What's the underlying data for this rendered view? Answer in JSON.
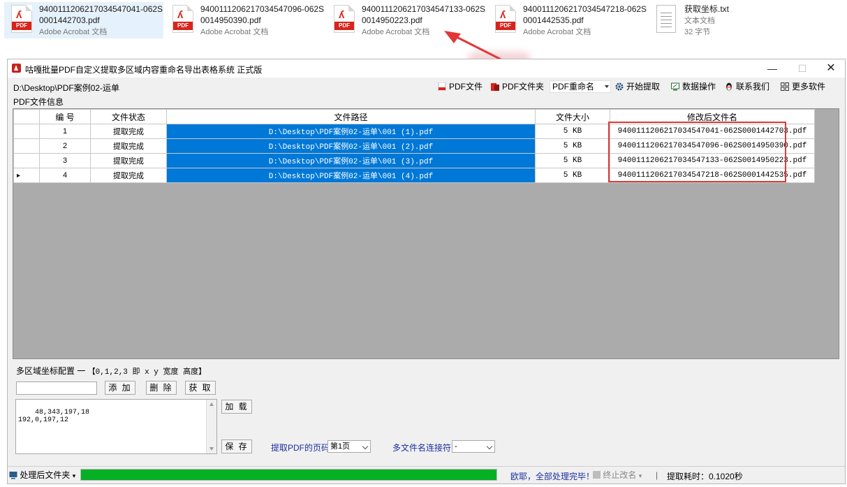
{
  "explorer": {
    "files": [
      {
        "name": "9400111206217034547041-062S0001442703.pdf",
        "type": "Adobe Acrobat 文档",
        "icon": "pdf-file-icon",
        "selected": true
      },
      {
        "name": "9400111206217034547096-062S0014950390.pdf",
        "type": "Adobe Acrobat 文档",
        "icon": "pdf-file-icon"
      },
      {
        "name": "9400111206217034547133-062S0014950223.pdf",
        "type": "Adobe Acrobat 文档",
        "icon": "pdf-file-icon"
      },
      {
        "name": "9400111206217034547218-062S0001442535.pdf",
        "type": "Adobe Acrobat 文档",
        "icon": "pdf-file-icon"
      },
      {
        "name": "获取坐标.txt",
        "type": "文本文档",
        "size": "32 字节",
        "icon": "text-file-icon"
      }
    ],
    "pdf_tag": "PDF"
  },
  "window": {
    "title": "咕嘎批量PDF自定义提取多区域内容重命名导出表格系统   正式版",
    "accent": "#0078d7"
  },
  "toolbar": {
    "path": "D:\\Desktop\\PDF案例02-运单",
    "pdf_file": "PDF文件",
    "pdf_folder": "PDF文件夹",
    "mode": "PDF重命名",
    "start": "开始提取",
    "data_ops": "数据操作",
    "contact": "联系我们",
    "more": "更多软件"
  },
  "grid": {
    "group_title": "PDF文件信息",
    "columns": [
      "编 号",
      "文件状态",
      "文件路径",
      "文件大小",
      "修改后文件名"
    ],
    "rows": [
      {
        "no": "1",
        "status": "提取完成",
        "path": "D:\\Desktop\\PDF案例02-运单\\001 (1).pdf",
        "size": "5 KB",
        "new_name": "9400111206217034547041-062S0001442703.pdf"
      },
      {
        "no": "2",
        "status": "提取完成",
        "path": "D:\\Desktop\\PDF案例02-运单\\001 (2).pdf",
        "size": "5 KB",
        "new_name": "9400111206217034547096-062S0014950390.pdf"
      },
      {
        "no": "3",
        "status": "提取完成",
        "path": "D:\\Desktop\\PDF案例02-运单\\001 (3).pdf",
        "size": "5 KB",
        "new_name": "9400111206217034547133-062S0014950223.pdf"
      },
      {
        "no": "4",
        "status": "提取完成",
        "path": "D:\\Desktop\\PDF案例02-运单\\001 (4).pdf",
        "size": "5 KB",
        "new_name": "9400111206217034547218-062S0001442535.pdf",
        "current": true
      }
    ],
    "row_marker": "▸"
  },
  "config": {
    "title": "多区域坐标配置 一",
    "hint": "【0,1,2,3 即 x y 宽度 高度】",
    "input_value": "",
    "add": "添 加",
    "delete": "删 除",
    "get": "获 取",
    "load": "加 载",
    "save": "保 存",
    "coords": "48,343,197,18\n192,0,197,12",
    "page_label": "提取PDF的页码",
    "page_value": "第1页",
    "joiner_label": "多文件名连接符",
    "joiner_value": "-"
  },
  "status": {
    "folder_button": "处理后文件夹",
    "progress": 1.0,
    "message": "欧耶，全部处理完毕！",
    "stop_label": "终止改名",
    "separator": "|",
    "elapsed": "提取耗时：0.1020秒"
  }
}
